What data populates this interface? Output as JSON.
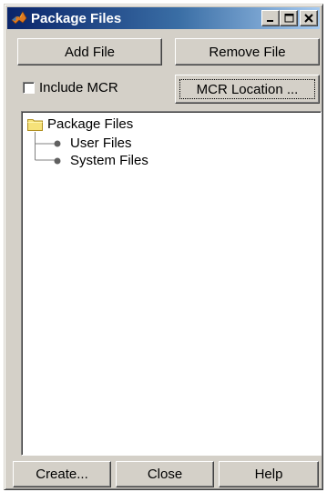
{
  "window": {
    "title": "Package Files",
    "icons": {
      "app": "matlab-logo-icon",
      "minimize": "minimize-icon",
      "maximize": "maximize-icon",
      "close": "close-icon"
    }
  },
  "toolbar": {
    "add_file_label": "Add File",
    "remove_file_label": "Remove File"
  },
  "options": {
    "include_mcr_label": "Include MCR",
    "include_mcr_checked": false,
    "mcr_location_label": "MCR Location ..."
  },
  "tree": {
    "root": {
      "label": "Package Files",
      "icon": "folder-icon"
    },
    "children": [
      {
        "label": "User Files",
        "icon": "bullet-icon"
      },
      {
        "label": "System Files",
        "icon": "bullet-icon"
      }
    ]
  },
  "footer": {
    "create_label": "Create...",
    "close_label": "Close",
    "help_label": "Help"
  }
}
